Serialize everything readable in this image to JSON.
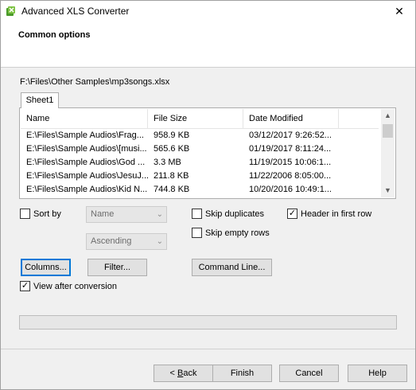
{
  "window": {
    "title": "Advanced XLS Converter",
    "close_glyph": "✕"
  },
  "header": {
    "title": "Common options"
  },
  "file_path": "F:\\Files\\Other Samples\\mp3songs.xlsx",
  "sheet_tab": "Sheet1",
  "grid": {
    "columns": [
      "Name",
      "File Size",
      "Date Modified"
    ],
    "rows": [
      [
        "E:\\Files\\Sample Audios\\Frag...",
        "958.9 KB",
        "03/12/2017 9:26:52..."
      ],
      [
        "E:\\Files\\Sample Audios\\[musi...",
        "565.6 KB",
        "01/19/2017 8:11:24..."
      ],
      [
        "E:\\Files\\Sample Audios\\God ...",
        "3.3 MB",
        "11/19/2015 10:06:1..."
      ],
      [
        "E:\\Files\\Sample Audios\\JesuJ...",
        "211.8 KB",
        "11/22/2006 8:05:00..."
      ],
      [
        "E:\\Files\\Sample Audios\\Kid N...",
        "744.8 KB",
        "10/20/2016 10:49:1..."
      ]
    ]
  },
  "options": {
    "sort_by_label": "Sort by",
    "sort_by_checked": false,
    "sort_field": "Name",
    "sort_order": "Ascending",
    "skip_duplicates_label": "Skip duplicates",
    "skip_duplicates_checked": false,
    "skip_empty_rows_label": "Skip empty rows",
    "skip_empty_rows_checked": false,
    "header_first_row_label": "Header in first row",
    "header_first_row_checked": true,
    "view_after_label": "View after conversion",
    "view_after_checked": true
  },
  "buttons": {
    "columns": "Columns...",
    "filter": "Filter...",
    "command_line": "Command Line...",
    "back_underlined": "B",
    "back_rest": "ack",
    "back_prefix": "< ",
    "finish": "Finish",
    "cancel": "Cancel",
    "help": "Help"
  },
  "progress": 0
}
